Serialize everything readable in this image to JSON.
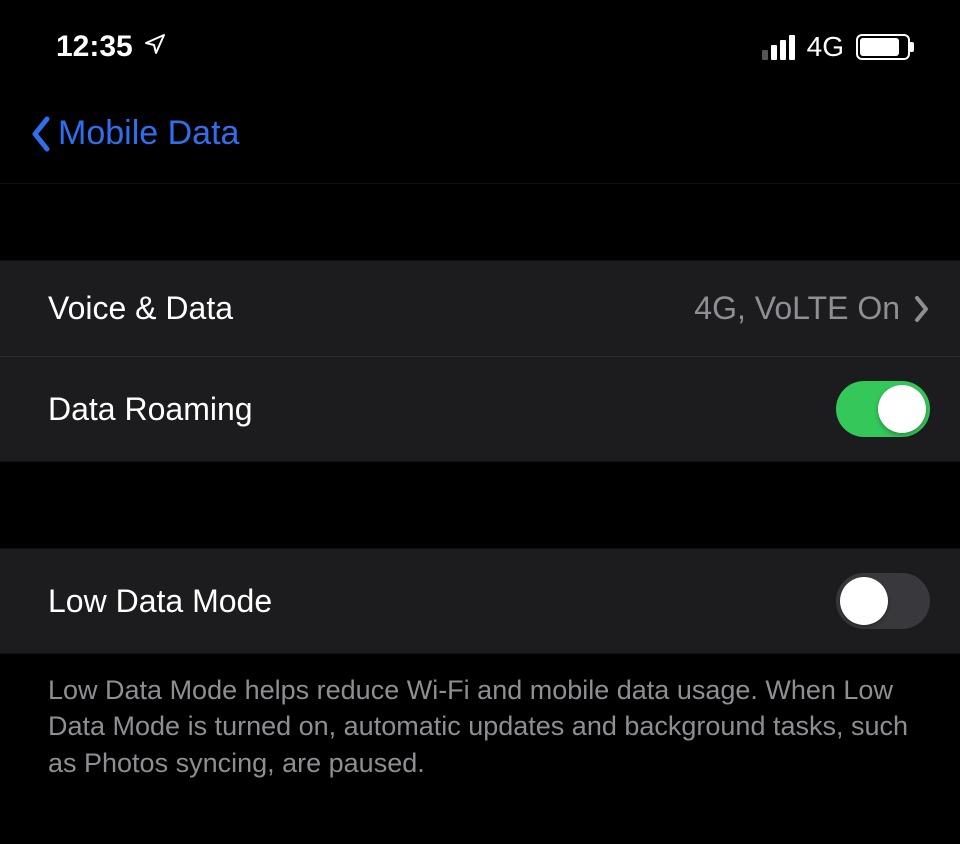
{
  "statusBar": {
    "time": "12:35",
    "networkLabel": "4G"
  },
  "nav": {
    "backLabel": "Mobile Data"
  },
  "rows": {
    "voiceData": {
      "label": "Voice & Data",
      "value": "4G, VoLTE On"
    },
    "dataRoaming": {
      "label": "Data Roaming",
      "on": true
    },
    "lowDataMode": {
      "label": "Low Data Mode",
      "on": false
    }
  },
  "footer": {
    "text": "Low Data Mode helps reduce Wi-Fi and mobile data usage. When Low Data Mode is turned on, automatic updates and background tasks, such as Photos syncing, are paused."
  }
}
